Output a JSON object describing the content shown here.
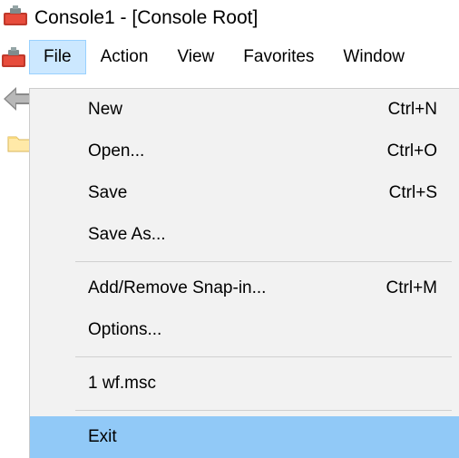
{
  "titlebar": {
    "title": "Console1 - [Console Root]"
  },
  "menubar": {
    "file": "File",
    "action": "Action",
    "view": "View",
    "favorites": "Favorites",
    "window": "Window"
  },
  "file_menu": {
    "new": {
      "label": "New",
      "shortcut": "Ctrl+N"
    },
    "open": {
      "label": "Open...",
      "shortcut": "Ctrl+O"
    },
    "save": {
      "label": "Save",
      "shortcut": "Ctrl+S"
    },
    "save_as": {
      "label": "Save As..."
    },
    "add_remove_snapin": {
      "label": "Add/Remove Snap-in...",
      "shortcut": "Ctrl+M"
    },
    "options": {
      "label": "Options..."
    },
    "recent1": {
      "label": "1 wf.msc"
    },
    "exit": {
      "label": "Exit"
    }
  }
}
